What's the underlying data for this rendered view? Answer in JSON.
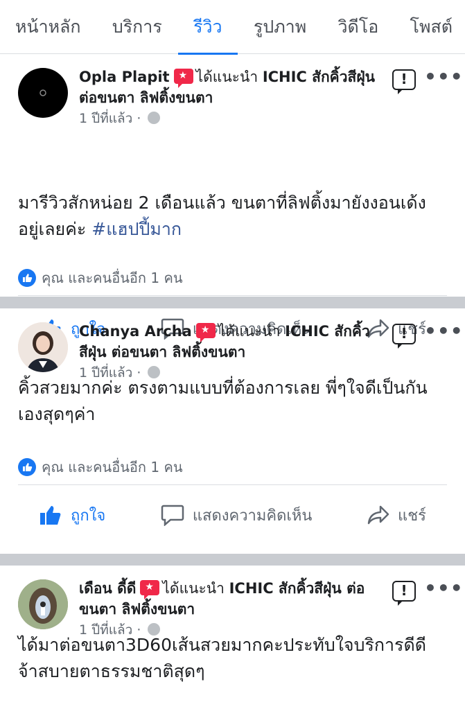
{
  "tabs": [
    {
      "label": "หน้าหลัก"
    },
    {
      "label": "บริการ"
    },
    {
      "label": "รีวิว",
      "active": true
    },
    {
      "label": "รูปภาพ"
    },
    {
      "label": "วิดีโอ"
    },
    {
      "label": "โพสต์"
    }
  ],
  "posts": [
    {
      "author": "Opla Plapit",
      "rec_text": "ได้แนะนำ",
      "page": "ICHIC สักคิ้วสีฝุ่น ต่อขนตา ลิฟติ้งขนตา",
      "time": "1 ปีที่แล้ว",
      "separator": "·",
      "text": "มารีวิวสักหน่อย 2 เดือนแล้ว ขนตาที่ลิฟติ้งมายังงอนเด้ง อยู่เลยค่ะ",
      "hashtag": "#แฮปปี้มาก",
      "reactions": "คุณ และคนอื่นอีก 1 คน"
    },
    {
      "author": "Chanya Archa",
      "rec_text": "ได้แนะนำ",
      "page": "ICHIC สักคิ้วสีฝุ่น ต่อขนตา ลิฟติ้งขนตา",
      "time": "1 ปีที่แล้ว",
      "separator": "·",
      "text": "คิ้วสวยมากค่ะ ตรงตามแบบที่ต้องการเลย พี่ๆใจดีเป็นกันเองสุดๆค่า",
      "hashtag": "",
      "reactions": "คุณ และคนอื่นอีก 1 คน"
    },
    {
      "author": "เดือน ดี้ดี",
      "rec_text": "ได้แนะนำ",
      "page": "ICHIC สักคิ้วสีฝุ่น ต่อขนตา ลิฟติ้งขนตา",
      "time": "1 ปีที่แล้ว",
      "separator": "·",
      "text": "ได้มาต่อขนตา3D60เส้นสวยมากคะประทับใจบริการดีดีจ้าสบายตาธรรมชาติสุดๆ",
      "hashtag": "",
      "reactions": ""
    }
  ],
  "actions": {
    "like": "ถูกใจ",
    "comment": "แสดงความคิดเห็น",
    "share": "แชร์"
  },
  "report_glyph": "!",
  "more_glyph": "•••",
  "colors": {
    "accent": "#1877f2",
    "badge": "#f02849",
    "separator": "#c9ccd1"
  }
}
